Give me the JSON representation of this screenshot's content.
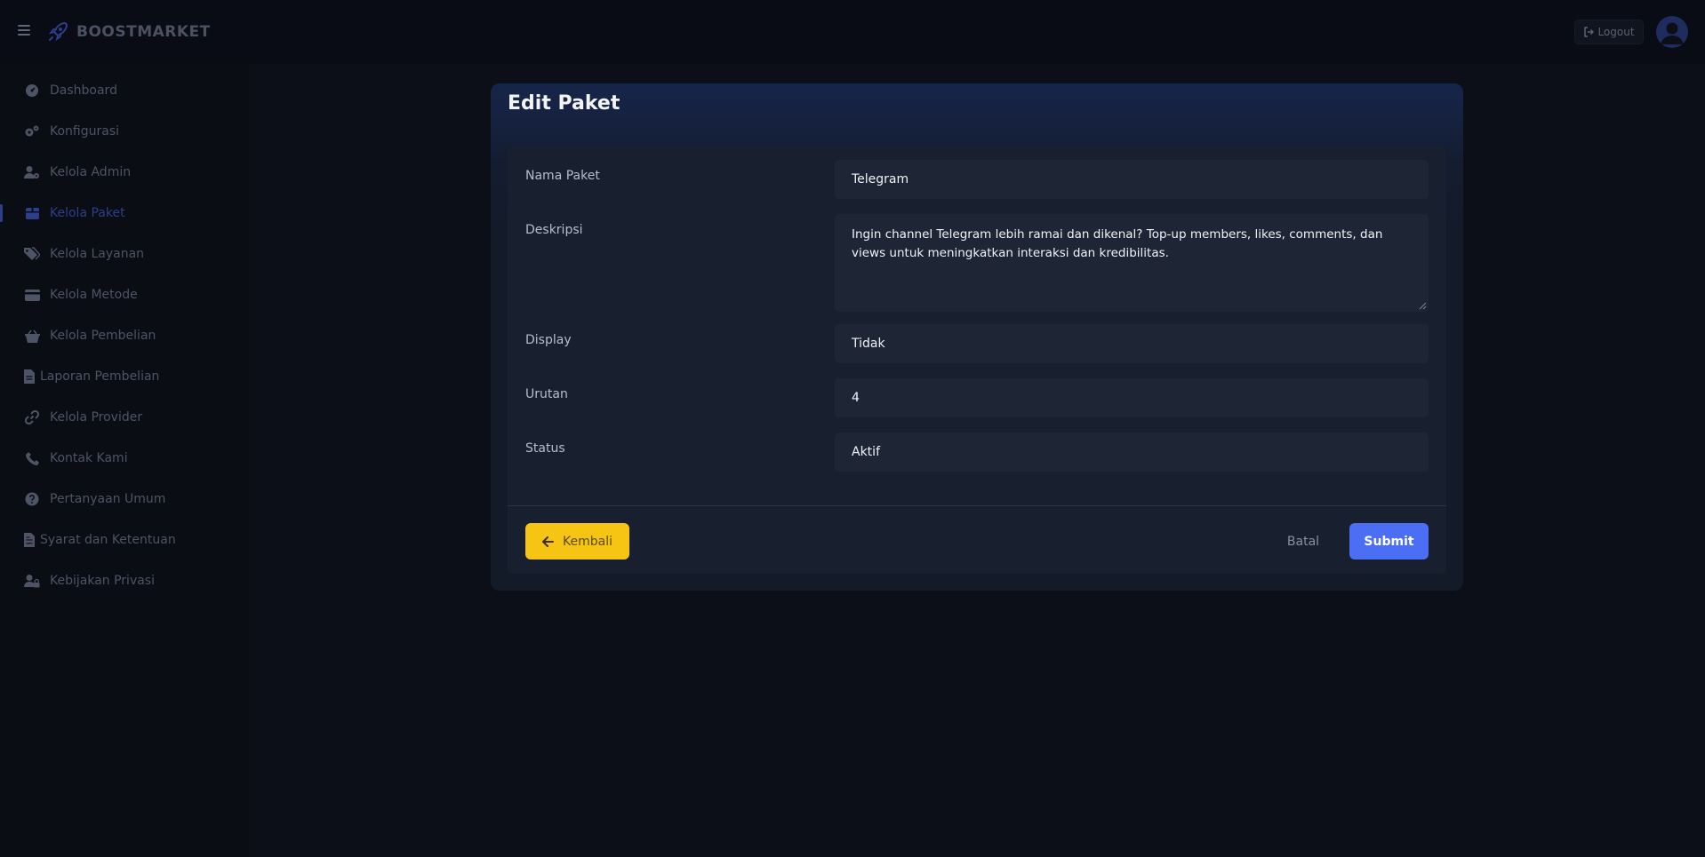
{
  "header": {
    "brand": "BOOSTMARKET",
    "logout_label": "Logout",
    "menu_icon": "hamburger-icon",
    "brand_icon": "rocket-icon",
    "avatar_icon": "user-avatar-icon"
  },
  "sidebar": {
    "items": [
      {
        "label": "Dashboard",
        "icon": "gauge-icon"
      },
      {
        "label": "Konfigurasi",
        "icon": "gears-icon"
      },
      {
        "label": "Kelola Admin",
        "icon": "user-gear-icon"
      },
      {
        "label": "Kelola Paket",
        "icon": "box-icon",
        "active": true
      },
      {
        "label": "Kelola Layanan",
        "icon": "tags-icon"
      },
      {
        "label": "Kelola Metode",
        "icon": "credit-card-icon"
      },
      {
        "label": "Kelola Pembelian",
        "icon": "basket-icon"
      },
      {
        "label": "Laporan Pembelian",
        "icon": "file-icon"
      },
      {
        "label": "Kelola Provider",
        "icon": "link-icon"
      },
      {
        "label": "Kontak Kami",
        "icon": "phone-icon"
      },
      {
        "label": "Pertanyaan Umum",
        "icon": "question-circle-icon"
      },
      {
        "label": "Syarat dan Ketentuan",
        "icon": "file-contract-icon"
      },
      {
        "label": "Kebijakan Privasi",
        "icon": "user-lock-icon"
      }
    ]
  },
  "card": {
    "title": "Edit Paket",
    "fields": {
      "nama_paket": {
        "label": "Nama Paket",
        "value": "Telegram"
      },
      "deskripsi": {
        "label": "Deskripsi",
        "value": "Ingin channel Telegram lebih ramai dan dikenal? Top-up members, likes, comments, dan views untuk meningkatkan interaksi dan kredibilitas."
      },
      "display": {
        "label": "Display",
        "value": "Tidak"
      },
      "urutan": {
        "label": "Urutan",
        "value": "4"
      },
      "status": {
        "label": "Status",
        "value": "Aktif"
      }
    },
    "buttons": {
      "back_label": "Kembali",
      "cancel_label": "Batal",
      "submit_label": "Submit"
    }
  },
  "colors": {
    "accent": "#4c6ef5",
    "warning": "#f6c413",
    "active_nav": "#2d3f8a",
    "background": "#0c0f18"
  }
}
